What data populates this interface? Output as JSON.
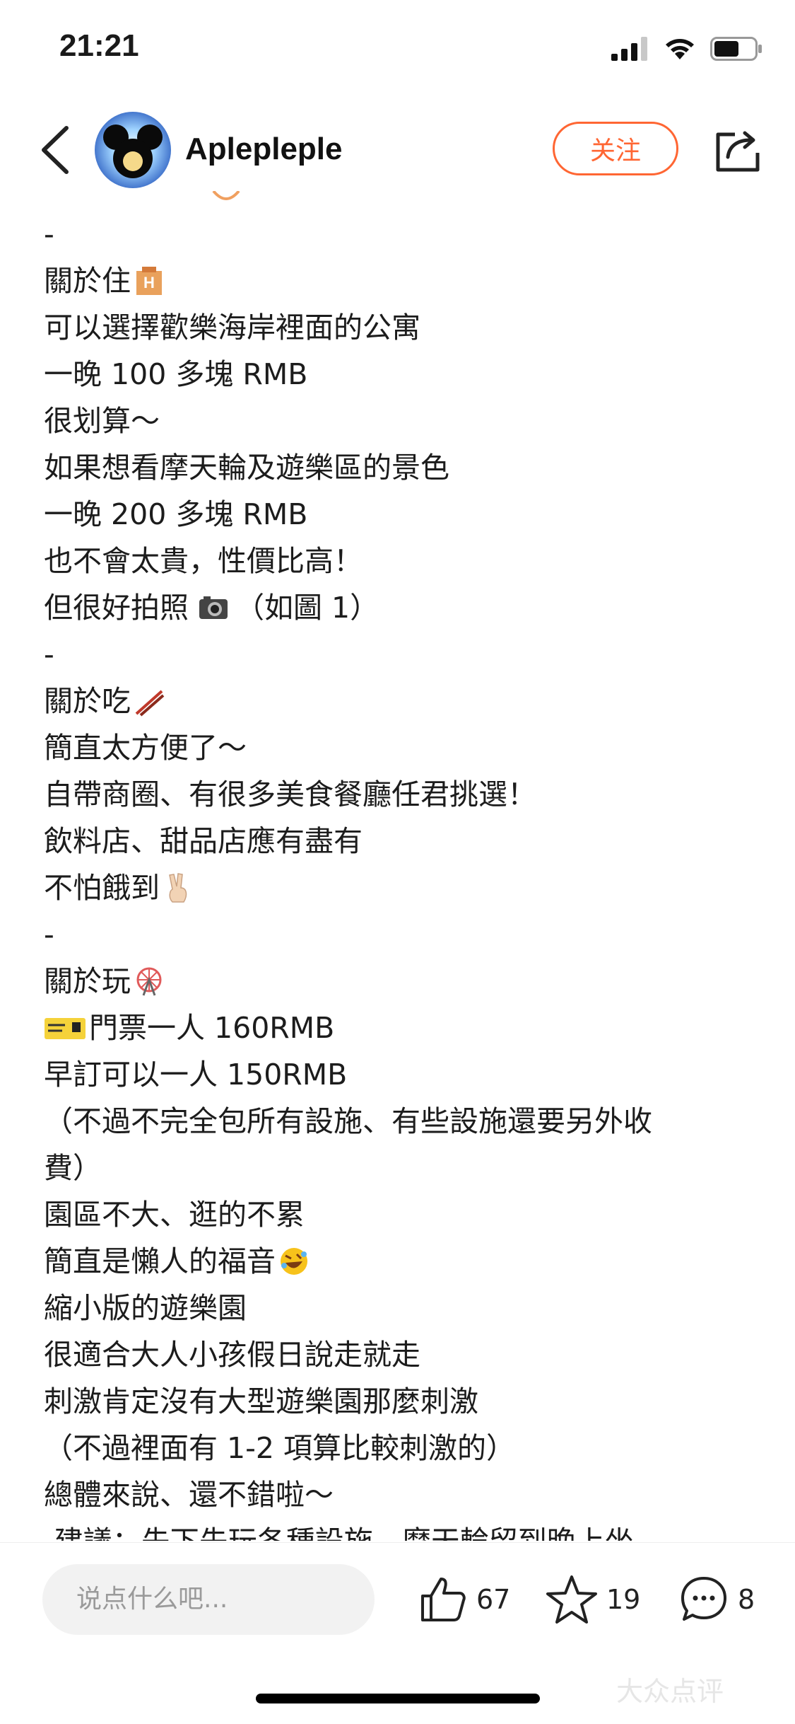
{
  "status_bar": {
    "time": "21:21"
  },
  "header": {
    "username": "Aplepleple",
    "follow_label": "关注"
  },
  "content": {
    "lines": [
      "-",
      "關於住",
      "可以選擇歡樂海岸裡面的公寓",
      "一晚 100 多塊 RMB",
      "很划算～",
      "如果想看摩天輪及遊樂區的景色",
      "一晚 200 多塊 RMB",
      "也不會太貴，性價比高！",
      "但很好拍照",
      "-",
      "關於吃",
      "簡直太方便了～",
      "自帶商圈、有很多美食餐廳任君挑選！",
      "飲料店、甜品店應有盡有",
      "不怕餓到",
      "-",
      "關於玩",
      "門票一人 160RMB",
      "早訂可以一人 150RMB",
      "（不過不完全包所有設施、有些設施還要另外收",
      "費）",
      "園區不大、逛的不累",
      "簡直是懶人的福音",
      "縮小版的遊樂園",
      "很適合大人小孩假日說走就走",
      "刺激肯定沒有大型遊樂園那麼刺激",
      "（不過裡面有 1-2 項算比較刺激的）",
      "總體來說、還不錯啦～",
      "-建議：先下先玩各種設施，摩天輪留到晚上坐"
    ],
    "photo_note": "（如圖 1）"
  },
  "bottom_bar": {
    "comment_placeholder": "说点什么吧...",
    "like_count": "67",
    "star_count": "19",
    "comment_count": "8"
  },
  "watermark": "大众点评",
  "colors": {
    "accent": "#ff6633",
    "text": "#1c1c1c",
    "placeholder": "#9a9a9a"
  }
}
